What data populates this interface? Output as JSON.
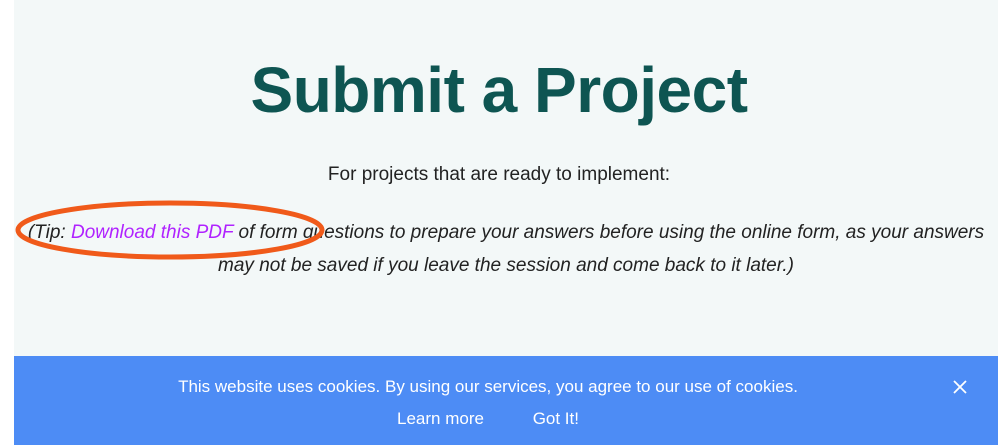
{
  "page": {
    "title": "Submit a Project",
    "subtitle": "For projects that are ready to implement:",
    "tip": {
      "prefix": "(Tip: ",
      "link_text": "Download this PDF",
      "suffix": " of form questions to prepare your answers before using the online form, as your answers may not be saved if you leave the session and come back to it later.)"
    }
  },
  "annotation": {
    "shape": "ellipse",
    "color": "#f05a1a"
  },
  "cookie_banner": {
    "message": "This website uses cookies. By using our services, you agree to our use of cookies.",
    "learn_more_label": "Learn more",
    "accept_label": "Got It!",
    "close_icon": "close-icon",
    "background": "#4d8cf5"
  },
  "colors": {
    "title": "#0e5552",
    "link": "#b023ff",
    "page_background": "#f3f8f8"
  }
}
